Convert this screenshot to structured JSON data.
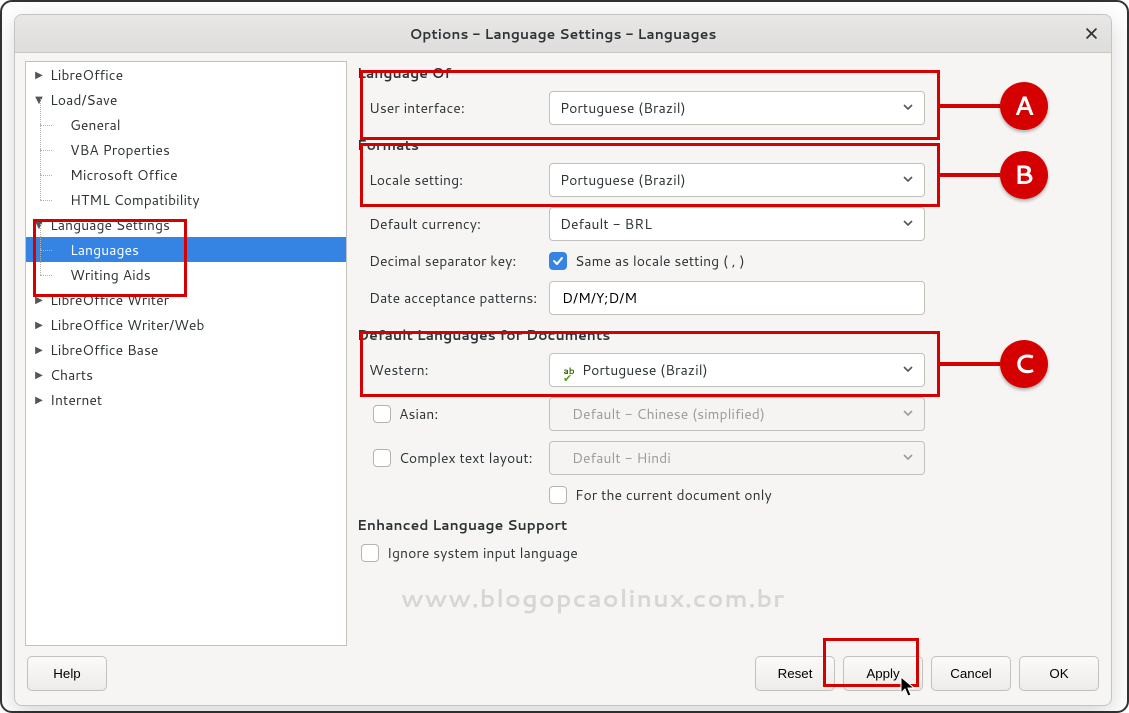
{
  "title": "Options - Language Settings - Languages",
  "tree": {
    "items": [
      {
        "label": "LibreOffice",
        "level": 0,
        "expander": "right"
      },
      {
        "label": "Load/Save",
        "level": 0,
        "expander": "down"
      },
      {
        "label": "General",
        "level": 1
      },
      {
        "label": "VBA Properties",
        "level": 1
      },
      {
        "label": "Microsoft Office",
        "level": 1
      },
      {
        "label": "HTML Compatibility",
        "level": 1
      },
      {
        "label": "Language Settings",
        "level": 0,
        "expander": "down"
      },
      {
        "label": "Languages",
        "level": 1,
        "selected": true
      },
      {
        "label": "Writing Aids",
        "level": 1
      },
      {
        "label": "LibreOffice Writer",
        "level": 0,
        "expander": "right"
      },
      {
        "label": "LibreOffice Writer/Web",
        "level": 0,
        "expander": "right"
      },
      {
        "label": "LibreOffice Base",
        "level": 0,
        "expander": "right"
      },
      {
        "label": "Charts",
        "level": 0,
        "expander": "right"
      },
      {
        "label": "Internet",
        "level": 0,
        "expander": "right"
      }
    ]
  },
  "section_language_of": "Language Of",
  "ui_label": "User interface:",
  "ui_value": "Portuguese (Brazil)",
  "section_formats": "Formats",
  "locale_label": "Locale setting:",
  "locale_value": "Portuguese (Brazil)",
  "currency_label": "Default currency:",
  "currency_value": "Default - BRL",
  "decimal_label": "Decimal separator key:",
  "decimal_check_text": "Same as locale setting ( , )",
  "decimal_checked": true,
  "date_label": "Date acceptance patterns:",
  "date_value": "D/M/Y;D/M",
  "section_default_langs": "Default Languages for Documents",
  "western_label": "Western:",
  "western_value": "Portuguese (Brazil)",
  "asian_label": "Asian:",
  "asian_value": "Default - Chinese (simplified)",
  "ctl_label": "Complex text layout:",
  "ctl_value": "Default - Hindi",
  "current_doc_only": "For the current document only",
  "section_enhanced": "Enhanced Language Support",
  "ignore_sys_input": "Ignore system input language",
  "watermark": "www.blogopcaolinux.com.br",
  "buttons": {
    "help": "Help",
    "reset": "Reset",
    "apply": "Apply",
    "cancel": "Cancel",
    "ok": "OK"
  },
  "callouts": {
    "a": "A",
    "b": "B",
    "c": "C"
  }
}
